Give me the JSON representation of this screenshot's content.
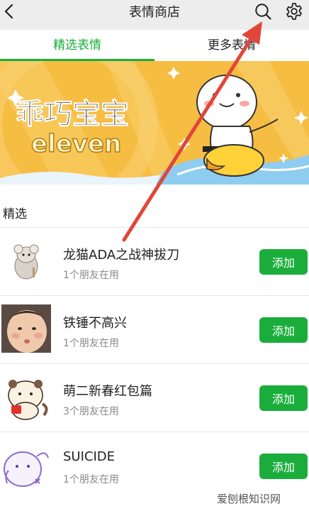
{
  "header": {
    "title": "表情商店"
  },
  "tabs": [
    {
      "label": "精选表情"
    },
    {
      "label": "更多表情"
    }
  ],
  "banner": {
    "title": "乖巧宝宝",
    "subtitle": "eleven"
  },
  "section": {
    "label": "精选"
  },
  "items": [
    {
      "name": "龙猫ADA之战神拔刀",
      "sub": "1个朋友在用",
      "button": "添加"
    },
    {
      "name": "铁锤不高兴",
      "sub": "1个朋友在用",
      "button": "添加"
    },
    {
      "name": "萌二新春红包篇",
      "sub": "3个朋友在用",
      "button": "添加"
    },
    {
      "name": "SUICIDE",
      "sub": "1个朋友在用",
      "button": "添加"
    }
  ],
  "watermark": "爱刨根知识网",
  "colors": {
    "accent": "#1aad3b",
    "topbar": "#ededed",
    "annotation": "#e0463a"
  },
  "icons": [
    "back-arrow-icon",
    "search-icon",
    "gear-icon"
  ]
}
